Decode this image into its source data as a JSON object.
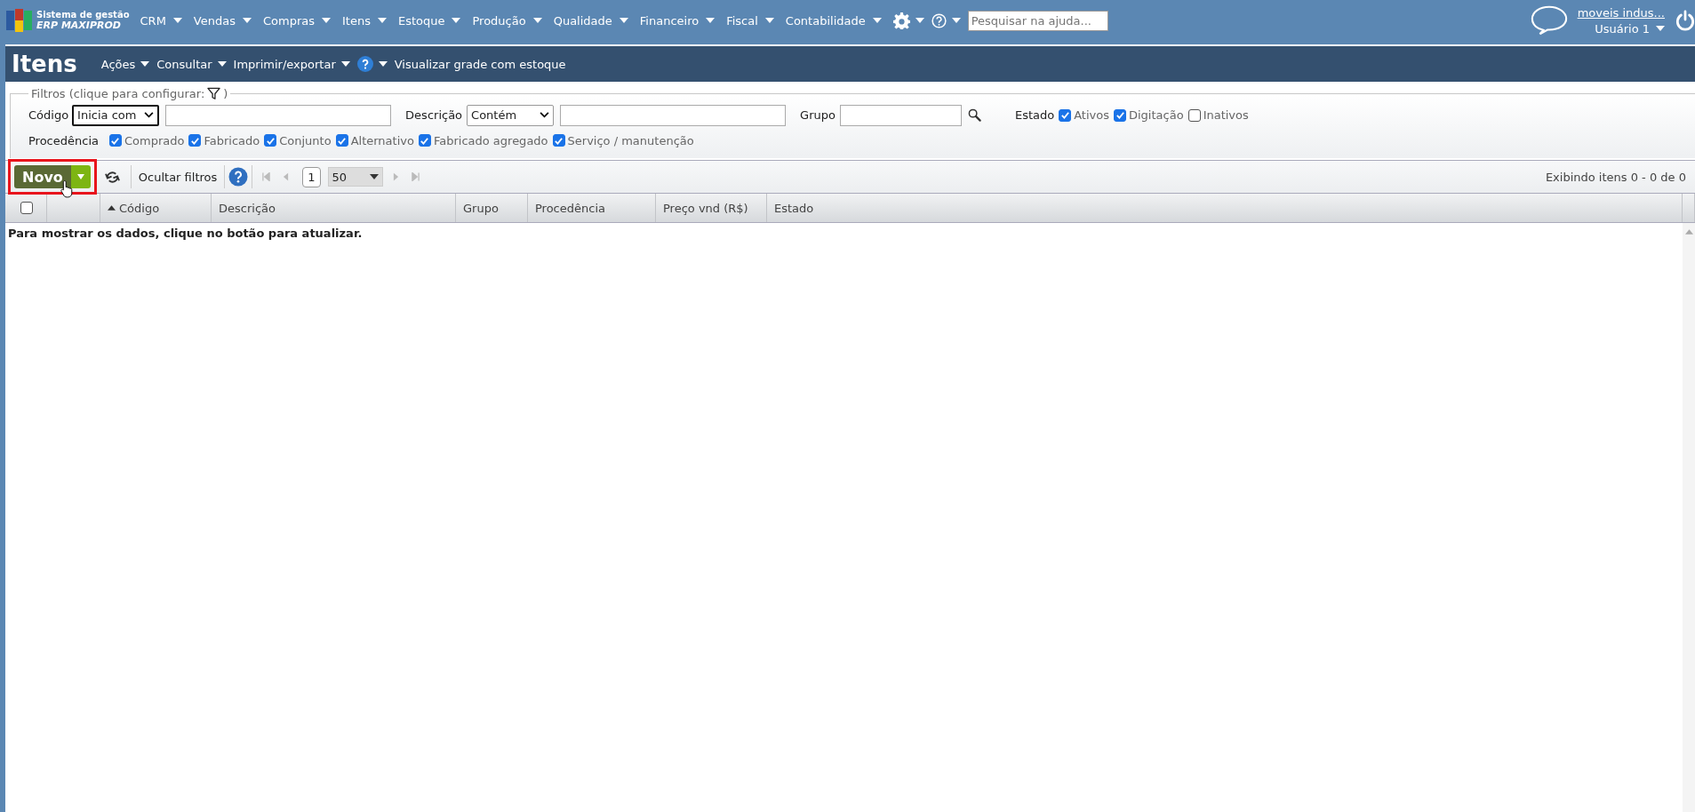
{
  "app": {
    "logo_line1": "Sistema de gestão",
    "logo_line2": "ERP MAXIPROD"
  },
  "menu": [
    "CRM",
    "Vendas",
    "Compras",
    "Itens",
    "Estoque",
    "Produção",
    "Qualidade",
    "Financeiro",
    "Fiscal",
    "Contabilidade"
  ],
  "help_search": {
    "placeholder": "Pesquisar na ajuda..."
  },
  "user": {
    "company": "moveis indus...",
    "name": "Usuário 1"
  },
  "page": {
    "title": "Itens",
    "actions": [
      "Ações",
      "Consultar",
      "Imprimir/exportar"
    ],
    "stock_grid": "Visualizar grade com estoque"
  },
  "filters": {
    "legend": "Filtros (clique para configurar:",
    "legend_end": ")",
    "code": {
      "label": "Código",
      "operator": "Inicia com"
    },
    "description": {
      "label": "Descrição",
      "operator": "Contém"
    },
    "group": {
      "label": "Grupo"
    },
    "state": {
      "label": "Estado",
      "options": [
        {
          "label": "Ativos",
          "checked": true
        },
        {
          "label": "Digitação",
          "checked": true
        },
        {
          "label": "Inativos",
          "checked": false
        }
      ]
    },
    "origin": {
      "label": "Procedência",
      "options": [
        {
          "label": "Comprado",
          "checked": true
        },
        {
          "label": "Fabricado",
          "checked": true
        },
        {
          "label": "Conjunto",
          "checked": true
        },
        {
          "label": "Alternativo",
          "checked": true
        },
        {
          "label": "Fabricado agregado",
          "checked": true
        },
        {
          "label": "Serviço / manutenção",
          "checked": true
        }
      ]
    }
  },
  "toolbar": {
    "new_button": {
      "label": "Novo",
      "highlighted": true
    },
    "hide_filters": "Ocultar filtros",
    "page": "1",
    "page_size": "50",
    "status": "Exibindo itens 0 - 0 de 0"
  },
  "table": {
    "select_all": {
      "checked": false
    },
    "columns": [
      {
        "label": "Código",
        "sorted": true
      },
      {
        "label": "Descrição",
        "sorted": false
      },
      {
        "label": "Grupo",
        "sorted": false
      },
      {
        "label": "Procedência",
        "sorted": false
      },
      {
        "label": "Preço vnd (R$)",
        "sorted": false
      },
      {
        "label": "Estado",
        "sorted": false
      }
    ],
    "empty_message": "Para mostrar os dados, clique no botão para atualizar."
  }
}
